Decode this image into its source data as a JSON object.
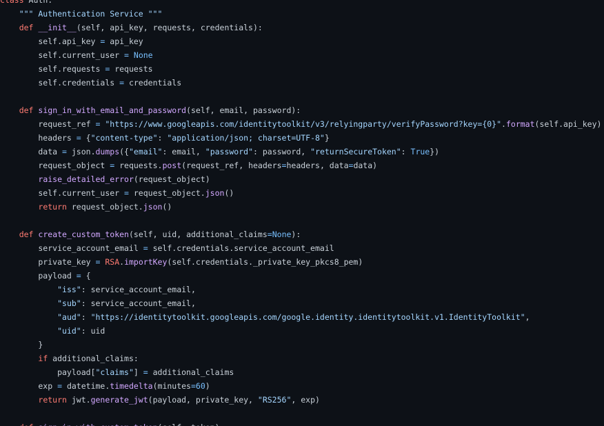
{
  "editor": {
    "language": "python",
    "theme": "dark",
    "colors": {
      "background": "#0d1117",
      "text": "#c9d1d9",
      "keyword": "#ff7b72",
      "function": "#d2a8ff",
      "string": "#a5d6ff",
      "constant": "#79c0ff"
    },
    "lines": [
      [
        {
          "t": "class",
          "k": "kw"
        },
        {
          "t": " Auth:",
          "k": "plain"
        }
      ],
      [
        {
          "t": "    \"\"\" Authentication Service \"\"\"",
          "k": "str"
        }
      ],
      [
        {
          "t": "    ",
          "k": "plain"
        },
        {
          "t": "def",
          "k": "kw"
        },
        {
          "t": " ",
          "k": "plain"
        },
        {
          "t": "__init__",
          "k": "fn"
        },
        {
          "t": "(self, api_key, requests, credentials):",
          "k": "plain"
        }
      ],
      [
        {
          "t": "        self.api_key ",
          "k": "plain"
        },
        {
          "t": "=",
          "k": "op"
        },
        {
          "t": " api_key",
          "k": "plain"
        }
      ],
      [
        {
          "t": "        self.current_user ",
          "k": "plain"
        },
        {
          "t": "=",
          "k": "op"
        },
        {
          "t": " ",
          "k": "plain"
        },
        {
          "t": "None",
          "k": "const"
        }
      ],
      [
        {
          "t": "        self.requests ",
          "k": "plain"
        },
        {
          "t": "=",
          "k": "op"
        },
        {
          "t": " requests",
          "k": "plain"
        }
      ],
      [
        {
          "t": "        self.credentials ",
          "k": "plain"
        },
        {
          "t": "=",
          "k": "op"
        },
        {
          "t": " credentials",
          "k": "plain"
        }
      ],
      [],
      [
        {
          "t": "    ",
          "k": "plain"
        },
        {
          "t": "def",
          "k": "kw"
        },
        {
          "t": " ",
          "k": "plain"
        },
        {
          "t": "sign_in_with_email_and_password",
          "k": "fn"
        },
        {
          "t": "(self, email, password):",
          "k": "plain"
        }
      ],
      [
        {
          "t": "        request_ref ",
          "k": "plain"
        },
        {
          "t": "=",
          "k": "op"
        },
        {
          "t": " ",
          "k": "plain"
        },
        {
          "t": "\"https://www.googleapis.com/identitytoolkit/v3/relyingparty/verifyPassword?key={0}\"",
          "k": "str"
        },
        {
          "t": ".",
          "k": "plain"
        },
        {
          "t": "format",
          "k": "fn"
        },
        {
          "t": "(self.api_key)",
          "k": "plain"
        }
      ],
      [
        {
          "t": "        headers ",
          "k": "plain"
        },
        {
          "t": "=",
          "k": "op"
        },
        {
          "t": " {",
          "k": "plain"
        },
        {
          "t": "\"content-type\"",
          "k": "str"
        },
        {
          "t": ": ",
          "k": "plain"
        },
        {
          "t": "\"application/json; charset=UTF-8\"",
          "k": "str"
        },
        {
          "t": "}",
          "k": "plain"
        }
      ],
      [
        {
          "t": "        data ",
          "k": "plain"
        },
        {
          "t": "=",
          "k": "op"
        },
        {
          "t": " json.",
          "k": "plain"
        },
        {
          "t": "dumps",
          "k": "fn"
        },
        {
          "t": "({",
          "k": "plain"
        },
        {
          "t": "\"email\"",
          "k": "str"
        },
        {
          "t": ": email, ",
          "k": "plain"
        },
        {
          "t": "\"password\"",
          "k": "str"
        },
        {
          "t": ": password, ",
          "k": "plain"
        },
        {
          "t": "\"returnSecureToken\"",
          "k": "str"
        },
        {
          "t": ": ",
          "k": "plain"
        },
        {
          "t": "True",
          "k": "const"
        },
        {
          "t": "})",
          "k": "plain"
        }
      ],
      [
        {
          "t": "        request_object ",
          "k": "plain"
        },
        {
          "t": "=",
          "k": "op"
        },
        {
          "t": " requests.",
          "k": "plain"
        },
        {
          "t": "post",
          "k": "fn"
        },
        {
          "t": "(request_ref, headers",
          "k": "plain"
        },
        {
          "t": "=",
          "k": "op"
        },
        {
          "t": "headers, data",
          "k": "plain"
        },
        {
          "t": "=",
          "k": "op"
        },
        {
          "t": "data)",
          "k": "plain"
        }
      ],
      [
        {
          "t": "        ",
          "k": "plain"
        },
        {
          "t": "raise_detailed_error",
          "k": "fn"
        },
        {
          "t": "(request_object)",
          "k": "plain"
        }
      ],
      [
        {
          "t": "        self.current_user ",
          "k": "plain"
        },
        {
          "t": "=",
          "k": "op"
        },
        {
          "t": " request_object.",
          "k": "plain"
        },
        {
          "t": "json",
          "k": "fn"
        },
        {
          "t": "()",
          "k": "plain"
        }
      ],
      [
        {
          "t": "        ",
          "k": "plain"
        },
        {
          "t": "return",
          "k": "kw"
        },
        {
          "t": " request_object.",
          "k": "plain"
        },
        {
          "t": "json",
          "k": "fn"
        },
        {
          "t": "()",
          "k": "plain"
        }
      ],
      [],
      [
        {
          "t": "    ",
          "k": "plain"
        },
        {
          "t": "def",
          "k": "kw"
        },
        {
          "t": " ",
          "k": "plain"
        },
        {
          "t": "create_custom_token",
          "k": "fn"
        },
        {
          "t": "(self, uid, additional_claims",
          "k": "plain"
        },
        {
          "t": "=",
          "k": "op"
        },
        {
          "t": "None",
          "k": "const"
        },
        {
          "t": "):",
          "k": "plain"
        }
      ],
      [
        {
          "t": "        service_account_email ",
          "k": "plain"
        },
        {
          "t": "=",
          "k": "op"
        },
        {
          "t": " self.credentials.service_account_email",
          "k": "plain"
        }
      ],
      [
        {
          "t": "        private_key ",
          "k": "plain"
        },
        {
          "t": "=",
          "k": "op"
        },
        {
          "t": " ",
          "k": "plain"
        },
        {
          "t": "RSA",
          "k": "kw"
        },
        {
          "t": ".",
          "k": "plain"
        },
        {
          "t": "importKey",
          "k": "fn"
        },
        {
          "t": "(self.credentials._private_key_pkcs8_pem)",
          "k": "plain"
        }
      ],
      [
        {
          "t": "        payload ",
          "k": "plain"
        },
        {
          "t": "=",
          "k": "op"
        },
        {
          "t": " {",
          "k": "plain"
        }
      ],
      [
        {
          "t": "            ",
          "k": "plain"
        },
        {
          "t": "\"iss\"",
          "k": "str"
        },
        {
          "t": ": service_account_email,",
          "k": "plain"
        }
      ],
      [
        {
          "t": "            ",
          "k": "plain"
        },
        {
          "t": "\"sub\"",
          "k": "str"
        },
        {
          "t": ": service_account_email,",
          "k": "plain"
        }
      ],
      [
        {
          "t": "            ",
          "k": "plain"
        },
        {
          "t": "\"aud\"",
          "k": "str"
        },
        {
          "t": ": ",
          "k": "plain"
        },
        {
          "t": "\"https://identitytoolkit.googleapis.com/google.identity.identitytoolkit.v1.IdentityToolkit\"",
          "k": "str"
        },
        {
          "t": ",",
          "k": "plain"
        }
      ],
      [
        {
          "t": "            ",
          "k": "plain"
        },
        {
          "t": "\"uid\"",
          "k": "str"
        },
        {
          "t": ": uid",
          "k": "plain"
        }
      ],
      [
        {
          "t": "        }",
          "k": "plain"
        }
      ],
      [
        {
          "t": "        ",
          "k": "plain"
        },
        {
          "t": "if",
          "k": "kw"
        },
        {
          "t": " additional_claims:",
          "k": "plain"
        }
      ],
      [
        {
          "t": "            payload[",
          "k": "plain"
        },
        {
          "t": "\"claims\"",
          "k": "str"
        },
        {
          "t": "] ",
          "k": "plain"
        },
        {
          "t": "=",
          "k": "op"
        },
        {
          "t": " additional_claims",
          "k": "plain"
        }
      ],
      [
        {
          "t": "        exp ",
          "k": "plain"
        },
        {
          "t": "=",
          "k": "op"
        },
        {
          "t": " datetime.",
          "k": "plain"
        },
        {
          "t": "timedelta",
          "k": "fn"
        },
        {
          "t": "(minutes",
          "k": "plain"
        },
        {
          "t": "=",
          "k": "op"
        },
        {
          "t": "60",
          "k": "const"
        },
        {
          "t": ")",
          "k": "plain"
        }
      ],
      [
        {
          "t": "        ",
          "k": "plain"
        },
        {
          "t": "return",
          "k": "kw"
        },
        {
          "t": " jwt.",
          "k": "plain"
        },
        {
          "t": "generate_jwt",
          "k": "fn"
        },
        {
          "t": "(payload, private_key, ",
          "k": "plain"
        },
        {
          "t": "\"RS256\"",
          "k": "str"
        },
        {
          "t": ", exp)",
          "k": "plain"
        }
      ],
      [],
      [
        {
          "t": "    ",
          "k": "plain"
        },
        {
          "t": "def",
          "k": "kw"
        },
        {
          "t": " ",
          "k": "plain"
        },
        {
          "t": "sign_in_with_custom_token",
          "k": "fn"
        },
        {
          "t": "(self, token):",
          "k": "plain"
        }
      ]
    ]
  }
}
